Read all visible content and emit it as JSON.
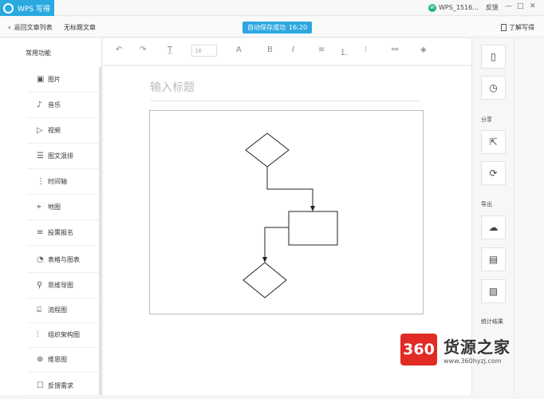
{
  "titlebar": {
    "app_name": "WPS 写得",
    "user_initials": "W",
    "user_name": "WPS_1516...",
    "feedback": "反馈",
    "win_min": "—",
    "win_max": "□",
    "win_close": "✕"
  },
  "subbar": {
    "back_label": "返回文章列表",
    "doc_name": "无标题文章",
    "autosave_text": "自动保存成功",
    "autosave_time": "16:20",
    "learn_label": "了解写得"
  },
  "sidebar": {
    "heading": "常用功能",
    "items": [
      {
        "label": "图片",
        "icon": "image-icon",
        "glyph": "▣"
      },
      {
        "label": "音乐",
        "icon": "music-icon",
        "glyph": "♪"
      },
      {
        "label": "视频",
        "icon": "video-icon",
        "glyph": "▷"
      },
      {
        "label": "图文混排",
        "icon": "layout-icon",
        "glyph": "☰"
      },
      {
        "label": "时间轴",
        "icon": "timeline-icon",
        "glyph": "⋮"
      },
      {
        "label": "地图",
        "icon": "map-pin-icon",
        "glyph": "⌖"
      },
      {
        "label": "投票报名",
        "icon": "vote-icon",
        "glyph": "≡"
      },
      {
        "label": "表格与图表",
        "icon": "chart-icon",
        "glyph": "◔"
      },
      {
        "label": "思维导图",
        "icon": "mindmap-icon",
        "glyph": "⚲"
      },
      {
        "label": "流程图",
        "icon": "flowchart-icon",
        "glyph": "⌸"
      },
      {
        "label": "组织架构图",
        "icon": "org-chart-icon",
        "glyph": "⫶"
      },
      {
        "label": "维恩图",
        "icon": "venn-icon",
        "glyph": "⊕"
      },
      {
        "label": "反馈需求",
        "icon": "feedback-icon",
        "glyph": "☐"
      }
    ]
  },
  "toolbar": {
    "undo": "↶",
    "redo": "↷",
    "heading_glyph": "T̲",
    "font_size": "16",
    "font_color_glyph": "A",
    "bold": "B",
    "italic": "I",
    "align": "≡",
    "ordered_list": "⒈",
    "unordered_list": "⁝",
    "link": "⚯",
    "fill": "◈"
  },
  "editor": {
    "title_placeholder": "输入标题"
  },
  "right_panel": {
    "share_label": "分享",
    "export_label": "导出",
    "stats_label": "统计结果",
    "phone": "▯",
    "history": "◷",
    "share_link": "⇱",
    "sync": "⟳",
    "export_cloud": "☁",
    "export_doc": "▤",
    "export_image": "▨"
  },
  "watermark": {
    "badge": "360",
    "text": "货源之家",
    "url": "www.360hyzj.com"
  },
  "colors": {
    "accent": "#2ea7e0",
    "watermark_red": "#e12b24"
  }
}
